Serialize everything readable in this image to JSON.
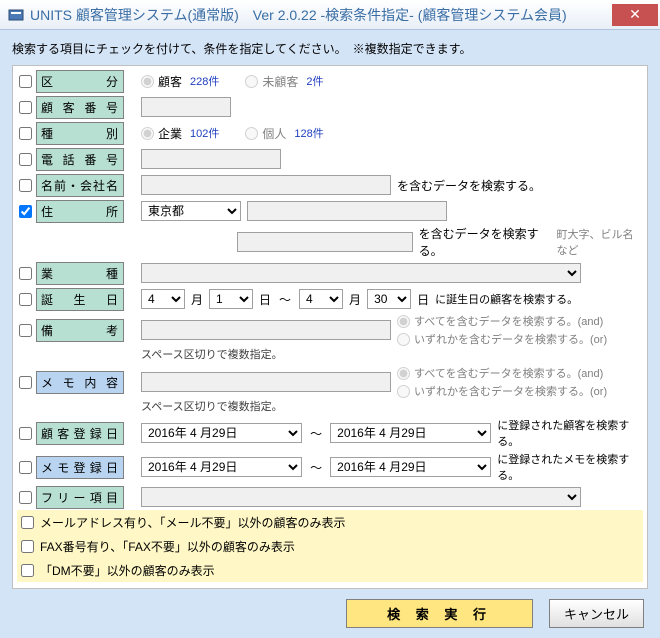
{
  "window": {
    "title": "UNITS 顧客管理システム(通常版)　Ver 2.0.22 -検索条件指定- (顧客管理システム会員)"
  },
  "instruction": "検索する項目にチェックを付けて、条件を指定してください。　※複数指定できます。",
  "labels": {
    "kubun": "区　分",
    "kokyakuBangou": "顧客番号",
    "shubetsu": "種　別",
    "denwa": "電話番号",
    "namae": "名前・会社名",
    "jusho": "住　所",
    "gyoshu": "業　種",
    "tanjobi": "誕生日",
    "bikou": "備考",
    "memo": "メモ内容",
    "kokyakuToroku": "顧客登録日",
    "memoToroku": "メモ登録日",
    "freeItem": "フリー項目"
  },
  "kubun": {
    "opt1": "顧客",
    "count1": "228件",
    "opt2": "未顧客",
    "count2": "2件"
  },
  "shubetsu": {
    "opt1": "企業",
    "count1": "102件",
    "opt2": "個人",
    "count2": "128件"
  },
  "namae_hint": "を含むデータを検索する。",
  "jusho": {
    "select_value": "東京都",
    "hint": "を含むデータを検索する。",
    "hint2": "町大字、ビル名など"
  },
  "tanjobi": {
    "m1": "4",
    "d1": "1",
    "m2": "4",
    "d2": "30",
    "m_label": "月",
    "d_label": "日",
    "sep": "～",
    "hint": "に誕生日の顧客を検索する。"
  },
  "space_hint": "スペース区切りで複数指定。",
  "andor": {
    "and": "すべてを含むデータを検索する。(and)",
    "or": "いずれかを含むデータを検索する。(or)"
  },
  "toroku": {
    "date1": "2016年 4 月29日",
    "date2": "2016年 4 月29日",
    "sep": "～",
    "hint_kokyaku": "に登録された顧客を検索する。",
    "hint_memo": "に登録されたメモを検索する。"
  },
  "yellow": {
    "mail": "メールアドレス有り、「メール不要」以外の顧客のみ表示",
    "fax": "FAX番号有り、「FAX不要」以外の顧客のみ表示",
    "dm": "「DM不要」以外の顧客のみ表示"
  },
  "buttons": {
    "search": "検 索 実 行",
    "cancel": "キャンセル"
  }
}
